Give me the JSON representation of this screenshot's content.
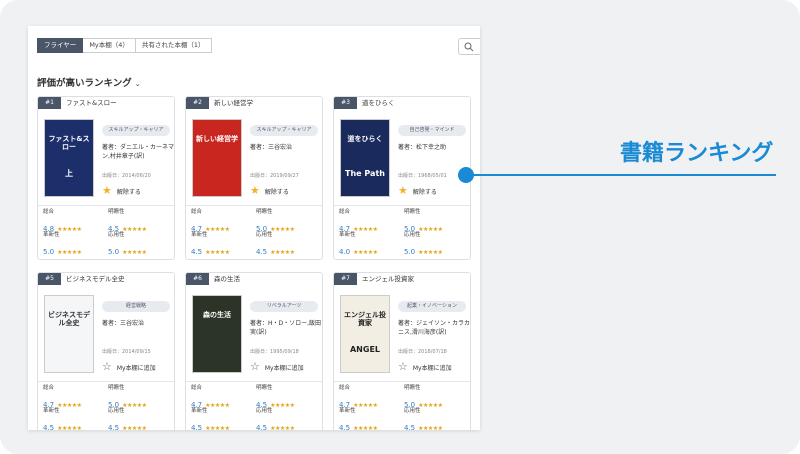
{
  "tabs": [
    {
      "label": "フライヤー",
      "active": true
    },
    {
      "label": "My本棚（4）",
      "active": false
    },
    {
      "label": "共有された本棚（1）",
      "active": false
    }
  ],
  "sort": {
    "label": "評価が高いランキング"
  },
  "callout": {
    "text": "書籍ランキング",
    "color": "#1a8ad4"
  },
  "metric_labels": {
    "overall": "総合",
    "clarity": "明瞭性",
    "innovation": "革新性",
    "applicability": "応用性"
  },
  "stars": "★★★★★",
  "books": [
    {
      "rank": "#1",
      "title": "ファスト&スロー",
      "tag": "スキルアップ・キャリア",
      "author": "著者：ダニエル・カーネマン,村井章子(訳)",
      "date": "出版日：2014/06/20",
      "action": "解除する",
      "action_state": "saved",
      "cover": {
        "bg": "#1d2f6b",
        "text": "ファスト&スロー",
        "sub": "上",
        "color": "#ffffff"
      },
      "scores": {
        "overall": "4.8",
        "clarity": "4.5",
        "innovation": "5.0",
        "applicability": "5.0"
      }
    },
    {
      "rank": "#2",
      "title": "新しい経営学",
      "tag": "スキルアップ・キャリア",
      "author": "著者：三谷宏治",
      "date": "出版日：2019/09/27",
      "action": "解除する",
      "action_state": "saved",
      "cover": {
        "bg": "#c8261e",
        "text": "新しい経営学",
        "sub": "",
        "color": "#ffffff"
      },
      "scores": {
        "overall": "4.7",
        "clarity": "5.0",
        "innovation": "4.5",
        "applicability": "4.5"
      }
    },
    {
      "rank": "#3",
      "title": "道をひらく",
      "tag": "自己啓発・マインド",
      "author": "著者：松下幸之助",
      "date": "出版日：1968/05/01",
      "action": "解除する",
      "action_state": "saved",
      "cover": {
        "bg": "#1b2a5c",
        "text": "道をひらく",
        "sub": "The Path",
        "color": "#ffffff"
      },
      "scores": {
        "overall": "4.7",
        "clarity": "5.0",
        "innovation": "4.0",
        "applicability": "5.0"
      }
    },
    {
      "rank": "#5",
      "title": "ビジネスモデル全史",
      "tag": "経営戦略",
      "author": "著者：三谷宏治",
      "date": "出版日：2014/09/15",
      "action": "My本棚に追加",
      "action_state": "unsaved",
      "cover": {
        "bg": "#f4f6f8",
        "text": "ビジネスモデル全史",
        "sub": "",
        "color": "#333333"
      },
      "scores": {
        "overall": "4.7",
        "clarity": "5.0",
        "innovation": "4.5",
        "applicability": "4.5"
      }
    },
    {
      "rank": "#6",
      "title": "森の生活",
      "tag": "リベラルアーツ",
      "author": "著者：H・D・ソロー,飯田実(訳)",
      "date": "出版日：1995/09/18",
      "action": "My本棚に追加",
      "action_state": "unsaved",
      "cover": {
        "bg": "#2c3428",
        "text": "森の生活",
        "sub": "",
        "color": "#ffffff"
      },
      "scores": {
        "overall": "4.7",
        "clarity": "4.5",
        "innovation": "4.5",
        "applicability": "4.5"
      }
    },
    {
      "rank": "#7",
      "title": "エンジェル投資家",
      "tag": "起業・イノベーション",
      "author": "著者：ジェイソン・カラカニス,滑川海彦(訳)",
      "date": "出版日：2018/07/18",
      "action": "My本棚に追加",
      "action_state": "unsaved",
      "cover": {
        "bg": "#f2eee4",
        "text": "エンジェル投資家",
        "sub": "ANGEL",
        "color": "#222222"
      },
      "scores": {
        "overall": "4.7",
        "clarity": "5.0",
        "innovation": "4.5",
        "applicability": "4.5"
      }
    }
  ]
}
